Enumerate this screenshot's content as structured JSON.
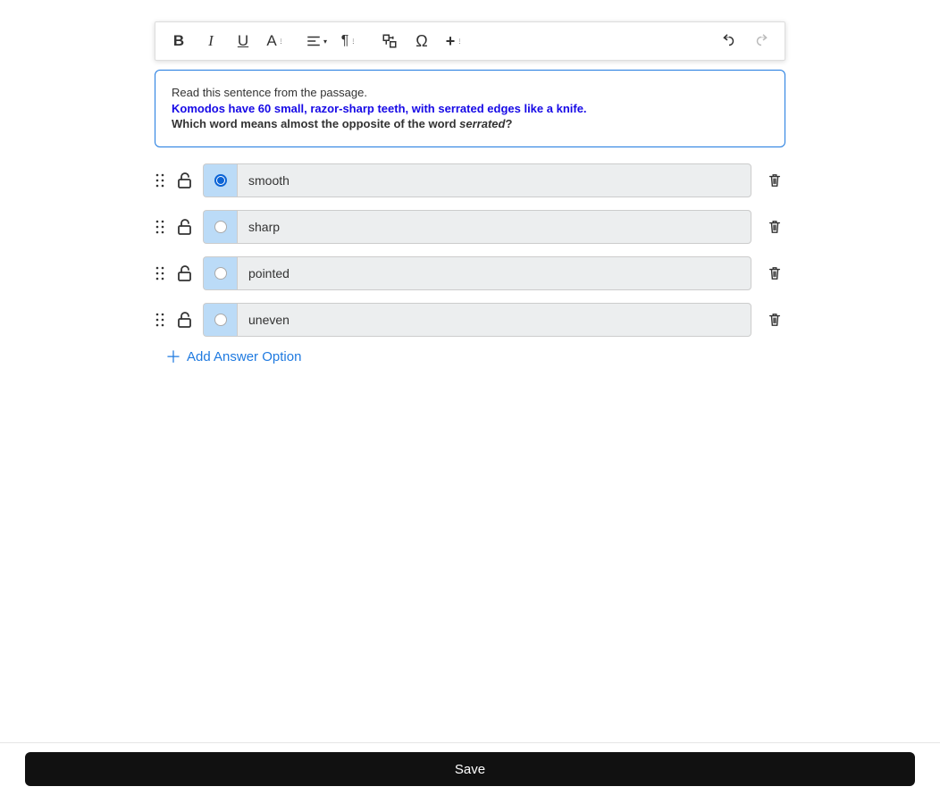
{
  "toolbar": {
    "bold": "B",
    "italic": "I",
    "underline": "U",
    "font": "A",
    "align": "align",
    "paragraph": "¶",
    "translate": "translate",
    "omega": "Ω",
    "insert": "+",
    "undo": "undo",
    "redo": "redo"
  },
  "question": {
    "line1": "Read this sentence from the passage.",
    "line2": "Komodos have 60 small, razor-sharp teeth, with serrated edges like a knife.",
    "line3_prefix": "Which word means almost the opposite of the word ",
    "line3_italic": "serrated",
    "line3_suffix": "?"
  },
  "answers": [
    {
      "label": "smooth",
      "selected": true
    },
    {
      "label": "sharp",
      "selected": false
    },
    {
      "label": "pointed",
      "selected": false
    },
    {
      "label": "uneven",
      "selected": false
    }
  ],
  "add_option_label": "Add Answer Option",
  "save_label": "Save"
}
